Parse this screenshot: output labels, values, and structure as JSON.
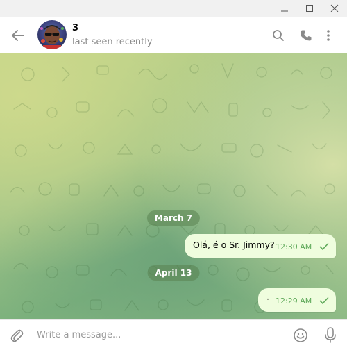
{
  "window": {
    "controls": [
      "minimize-icon",
      "maximize-icon",
      "close-icon"
    ]
  },
  "header": {
    "title": "3",
    "status": "last seen recently",
    "icons": [
      "back-arrow-icon",
      "search-icon",
      "phone-icon",
      "more-vertical-icon"
    ]
  },
  "chat": {
    "dates": [
      "March 7",
      "April 13"
    ],
    "messages": [
      {
        "text": "Olá, é o Sr. Jimmy?",
        "time": "12:30 AM",
        "status": "sent-check-icon"
      },
      {
        "text": "·",
        "time": "12:29 AM",
        "status": "sent-check-icon"
      }
    ],
    "colors": {
      "bubble": "#effdde",
      "time": "#5fa95a",
      "date_pill": "#6f9a5f"
    }
  },
  "composer": {
    "placeholder": "Write a message...",
    "value": "",
    "icons": [
      "paperclip-icon",
      "emoji-icon",
      "microphone-icon"
    ]
  },
  "colors": {
    "accent": "#5fa95a",
    "icon": "#8a8a8a"
  }
}
